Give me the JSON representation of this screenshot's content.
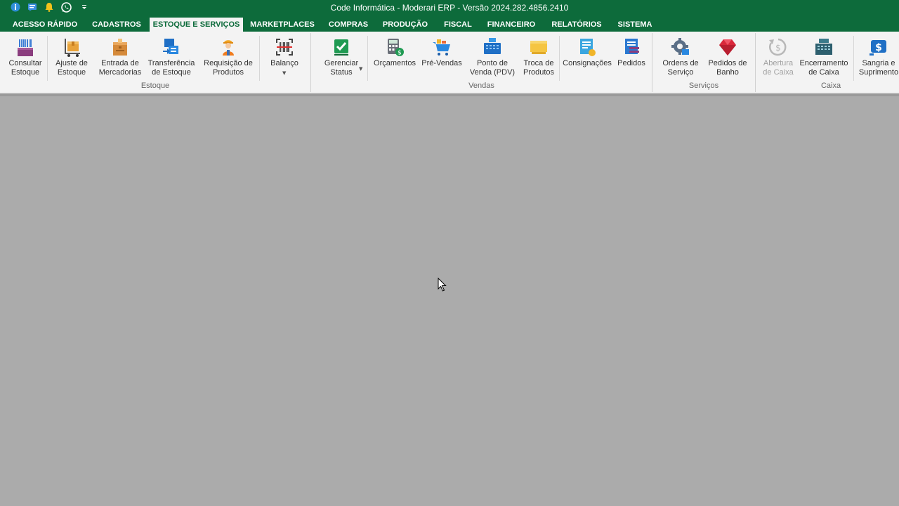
{
  "window": {
    "title": "Code Informática - Moderari ERP - Versão 2024.282.4856.2410"
  },
  "quick_access": [
    {
      "icon": "info-icon"
    },
    {
      "icon": "message-icon"
    },
    {
      "icon": "bell-icon"
    },
    {
      "icon": "whatsapp-icon"
    },
    {
      "icon": "customize-dropdown-icon"
    }
  ],
  "tabs": [
    {
      "label": "ACESSO RÁPIDO"
    },
    {
      "label": "CADASTROS"
    },
    {
      "label": "ESTOQUE E SERVIÇOS"
    },
    {
      "label": "MARKETPLACES"
    },
    {
      "label": "COMPRAS"
    },
    {
      "label": "PRODUÇÃO"
    },
    {
      "label": "FISCAL"
    },
    {
      "label": "FINANCEIRO"
    },
    {
      "label": "RELATÓRIOS"
    },
    {
      "label": "SISTEMA"
    }
  ],
  "groups": {
    "estoque": {
      "label": "Estoque",
      "buttons": [
        {
          "label": "Consultar\nEstoque",
          "icon": "barcode-boxes-icon"
        },
        {
          "label": "Ajuste de\nEstoque",
          "icon": "box-cart-icon"
        },
        {
          "label": "Entrada de\nMercadorias",
          "icon": "package-icon"
        },
        {
          "label": "Transferência\nde Estoque",
          "icon": "transfer-icon"
        },
        {
          "label": "Requisição de\nProdutos",
          "icon": "worker-icon"
        },
        {
          "label": "Balanço",
          "icon": "barcode-scanner-icon"
        }
      ]
    },
    "vendas": {
      "label": "Vendas",
      "buttons": [
        {
          "label": "Gerenciar\nStatus",
          "icon": "status-check-icon"
        },
        {
          "label": "Orçamentos",
          "icon": "calculator-icon"
        },
        {
          "label": "Pré-Vendas",
          "icon": "shopping-cart-icon"
        },
        {
          "label": "Ponto de\nVenda (PDV)",
          "icon": "pos-terminal-icon"
        },
        {
          "label": "Troca de\nProdutos",
          "icon": "exchange-icon"
        },
        {
          "label": "Consignações",
          "icon": "consignment-icon"
        },
        {
          "label": "Pedidos",
          "icon": "orders-icon"
        }
      ]
    },
    "servicos": {
      "label": "Serviços",
      "buttons": [
        {
          "label": "Ordens de\nServiço",
          "icon": "gear-wrench-icon"
        },
        {
          "label": "Pedidos de\nBanho",
          "icon": "ruby-icon"
        }
      ]
    },
    "caixa": {
      "label": "Caixa",
      "buttons": [
        {
          "label": "Abertura\nde Caixa",
          "icon": "cash-open-icon",
          "disabled": true
        },
        {
          "label": "Encerramento\nde Caixa",
          "icon": "cash-register-icon"
        },
        {
          "label": "Sangria e\nSuprimento",
          "icon": "money-transfer-icon"
        }
      ]
    }
  },
  "colors": {
    "titlebar": "#0d6b3b",
    "ribbon": "#f3f3f3",
    "workspace": "#ababab"
  }
}
